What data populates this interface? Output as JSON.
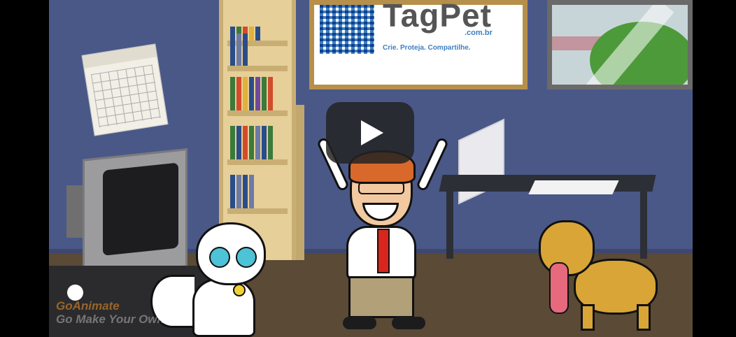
{
  "video": {
    "poster": {
      "brand": "TagPet",
      "domain": ".com.br",
      "slogan": "Crie. Proteja. Compartilhe."
    },
    "watermark": {
      "line1_brand": "GoAnimate",
      "line2": "Go Make Your Own"
    },
    "controls": {
      "play_icon": "play-icon",
      "progress_fraction": 0.0
    },
    "colors": {
      "wall": "#4a5888",
      "floor": "#5a4a36",
      "poster_accent": "#3f7fbf",
      "play_button": "#232323"
    }
  }
}
